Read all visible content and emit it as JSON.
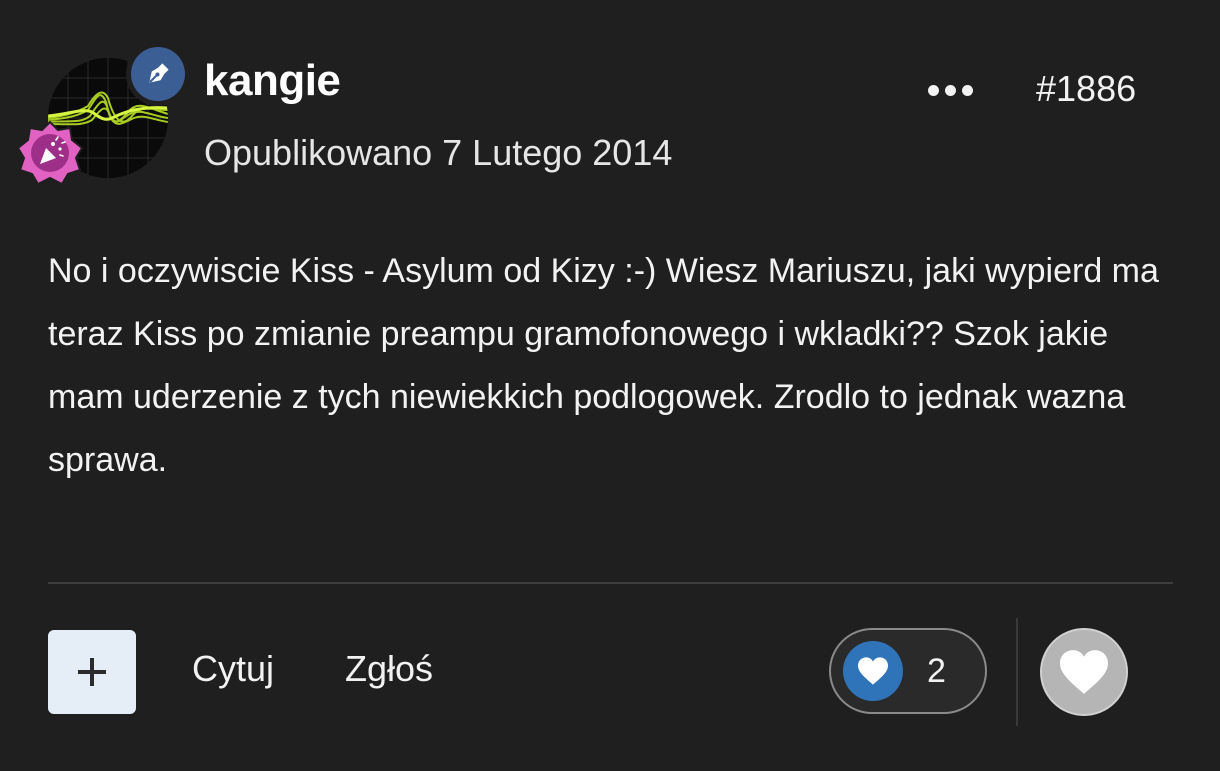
{
  "post": {
    "author": "kangie",
    "date": "Opublikowano 7 Lutego 2014",
    "number": "#1886",
    "body": "No i oczywiscie Kiss - Asylum od Kizy :-) Wiesz Mariuszu, jaki wypierd ma teraz Kiss po zmianie preampu gramofonowego i wkladki?? Szok jakie mam uderzenie z tych niewiekkich podlogowek. Zrodlo to jednak wazna sprawa."
  },
  "footer": {
    "add_label": "+",
    "quote_label": "Cytuj",
    "report_label": "Zgłoś",
    "reaction_count": "2"
  },
  "icons": {
    "role": "pen-nib-icon",
    "achievement": "party-popper-icon",
    "more": "ellipsis-icon",
    "reaction": "heart-icon"
  },
  "colors": {
    "background": "#1f1f1f",
    "role_badge": "#3b5e94",
    "achievement_badge": "#b23f9c",
    "reaction_blue": "#2f73b8",
    "add_button": "#e5edf6"
  }
}
